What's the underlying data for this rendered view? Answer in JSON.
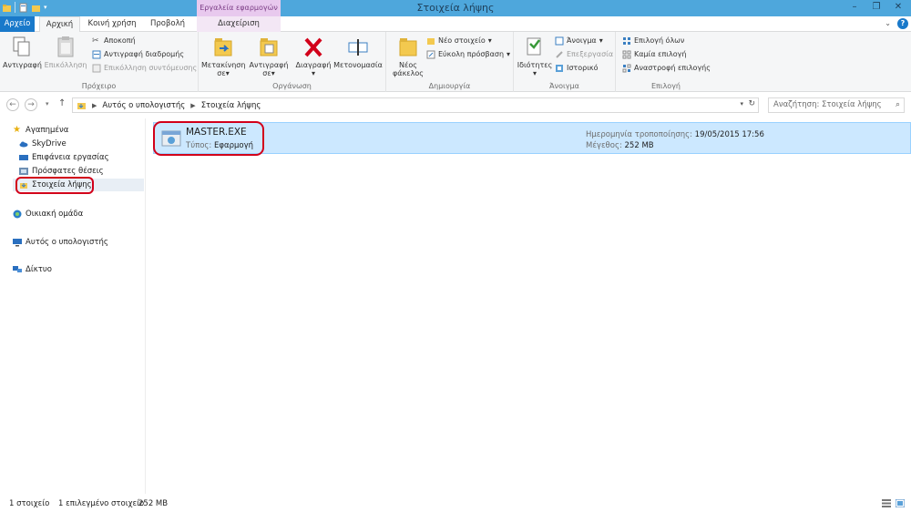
{
  "window": {
    "title": "Στοιχεία λήψης"
  },
  "ribbon_context": {
    "label": "Εργαλεία εφαρμογών"
  },
  "tabs": [
    {
      "label": "Αρχείο"
    },
    {
      "label": "Αρχική"
    },
    {
      "label": "Κοινή χρήση"
    },
    {
      "label": "Προβολή"
    },
    {
      "label": "Διαχείριση"
    }
  ],
  "ribbon": {
    "clipboard": {
      "label": "Πρόχειρο",
      "copy": "Αντιγραφή",
      "paste": "Επικόλληση",
      "cut": "Αποκοπή",
      "copy_path": "Αντιγραφή διαδρομής",
      "paste_shortcut": "Επικόλληση συντόμευσης"
    },
    "organize": {
      "label": "Οργάνωση",
      "move_to_l1": "Μετακίνηση",
      "move_to_l2": "σε",
      "copy_to_l1": "Αντιγραφή",
      "copy_to_l2": "σε",
      "delete": "Διαγραφή",
      "rename": "Μετονομασία"
    },
    "new": {
      "label": "Δημιουργία",
      "new_folder_l1": "Νέος",
      "new_folder_l2": "φάκελος",
      "new_item": "Νέο στοιχείο",
      "easy_access": "Εύκολη πρόσβαση"
    },
    "open": {
      "label": "Άνοιγμα",
      "properties": "Ιδιότητες",
      "open": "Άνοιγμα",
      "edit": "Επεξεργασία",
      "history": "Ιστορικό"
    },
    "select": {
      "label": "Επιλογή",
      "select_all": "Επιλογή όλων",
      "select_none": "Καμία επιλογή",
      "invert": "Αναστροφή επιλογής"
    }
  },
  "address": {
    "crumbs": [
      "Αυτός ο υπολογιστής",
      "Στοιχεία λήψης"
    ],
    "search_placeholder": "Αναζήτηση: Στοιχεία λήψης"
  },
  "nav": {
    "favorites": "Αγαπημένα",
    "skydrive": "SkyDrive",
    "desktop": "Επιφάνεια εργασίας",
    "recent": "Πρόσφατες θέσεις",
    "downloads": "Στοιχεία λήψης",
    "homegroup": "Οικιακή ομάδα",
    "this_pc": "Αυτός ο υπολογιστής",
    "network": "Δίκτυο"
  },
  "file": {
    "name": "MASTER.EXE",
    "type_label": "Τύπος:",
    "type_value": "Εφαρμογή",
    "date_label": "Ημερομηνία τροποποίησης:",
    "date_value": "19/05/2015 17:56",
    "size_label": "Μέγεθος:",
    "size_value": "252 MB"
  },
  "status": {
    "count": "1 στοιχείο",
    "selected": "1 επιλεγμένο στοιχείο",
    "size": "252 MB"
  },
  "colors": {
    "titlebar": "#4ea7dc",
    "file_tab": "#1979ca",
    "context_tab": "#e8c9ee",
    "selection": "#cce8ff",
    "highlight": "#d2001a"
  }
}
